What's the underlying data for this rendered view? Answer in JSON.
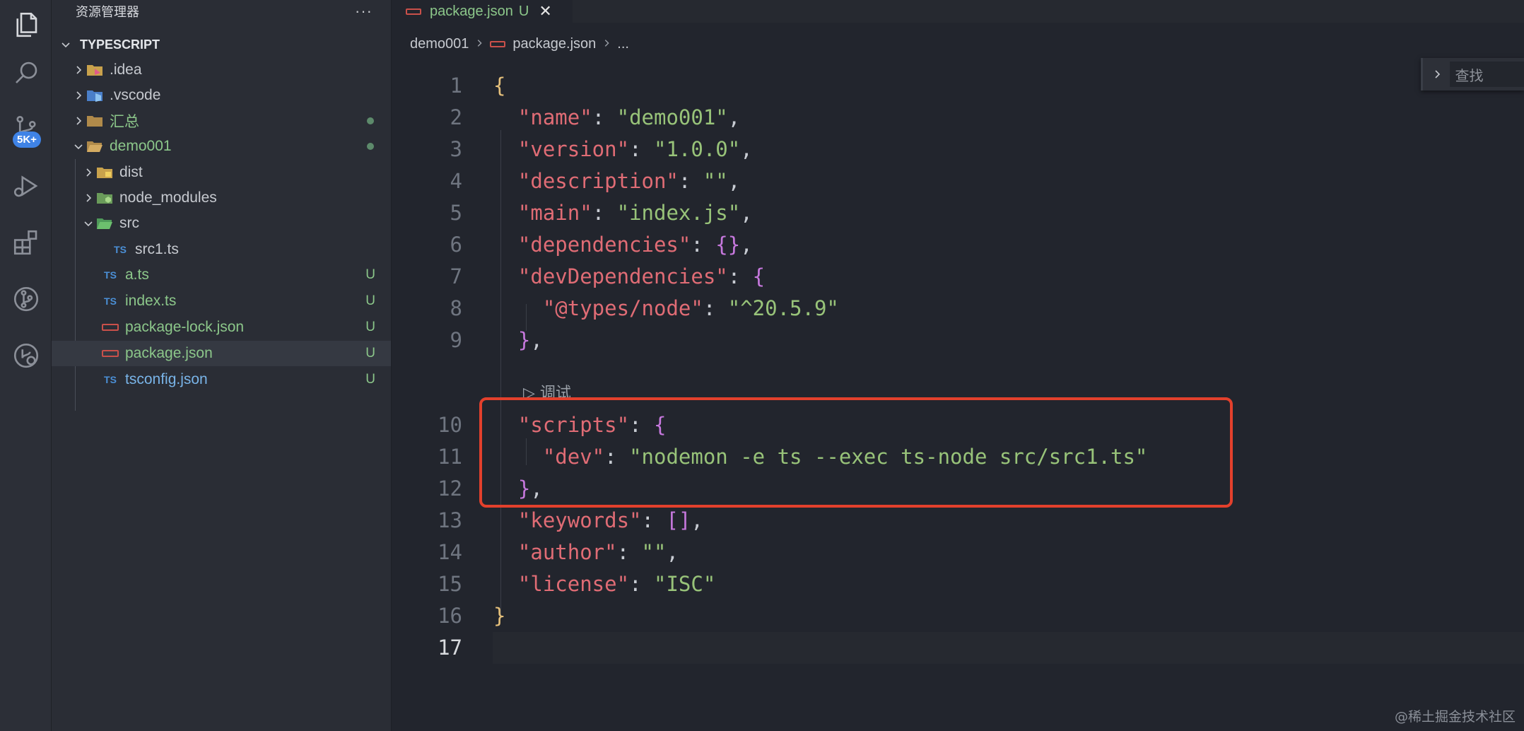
{
  "activity_bar": {
    "badge": "5K+"
  },
  "sidebar": {
    "title": "资源管理器",
    "more": "···",
    "section": "TYPESCRIPT",
    "items": [
      {
        "label": ".idea",
        "status": ""
      },
      {
        "label": ".vscode",
        "status": ""
      },
      {
        "label": "汇总",
        "status": "dot"
      },
      {
        "label": "demo001",
        "status": "dot"
      },
      {
        "label": "dist",
        "status": ""
      },
      {
        "label": "node_modules",
        "status": ""
      },
      {
        "label": "src",
        "status": ""
      },
      {
        "label": "src1.ts",
        "status": ""
      },
      {
        "label": "a.ts",
        "status": "U"
      },
      {
        "label": "index.ts",
        "status": "U"
      },
      {
        "label": "package-lock.json",
        "status": "U"
      },
      {
        "label": "package.json",
        "status": "U"
      },
      {
        "label": "tsconfig.json",
        "status": "U"
      }
    ],
    "ts_icon_text": "TS"
  },
  "tab": {
    "name": "package.json",
    "status": "U",
    "close": "✕"
  },
  "breadcrumb": {
    "folder": "demo001",
    "file": "package.json",
    "more": "..."
  },
  "find": {
    "placeholder": "查找"
  },
  "editor": {
    "line_numbers": [
      "1",
      "2",
      "3",
      "4",
      "5",
      "6",
      "7",
      "8",
      "9",
      "10",
      "11",
      "12",
      "13",
      "14",
      "15",
      "16",
      "17"
    ],
    "codelens": "▷ 调试",
    "lines": {
      "l1": "{",
      "name_k": "\"name\"",
      "name_v": "\"demo001\"",
      "version_k": "\"version\"",
      "version_v": "\"1.0.0\"",
      "description_k": "\"description\"",
      "description_v": "\"\"",
      "main_k": "\"main\"",
      "main_v": "\"index.js\"",
      "deps_k": "\"dependencies\"",
      "deps_v": "{}",
      "devdeps_k": "\"devDependencies\"",
      "devdeps_open": "{",
      "types_k": "\"@types/node\"",
      "types_v": "\"^20.5.9\"",
      "devdeps_close": "}",
      "scripts_k": "\"scripts\"",
      "scripts_open": "{",
      "dev_k": "\"dev\"",
      "dev_v": "\"nodemon -e ts --exec ts-node src/src1.ts\"",
      "scripts_close": "}",
      "keywords_k": "\"keywords\"",
      "keywords_v": "[]",
      "author_k": "\"author\"",
      "author_v": "\"\"",
      "license_k": "\"license\"",
      "license_v": "\"ISC\"",
      "l16": "}"
    }
  },
  "watermark": "@稀土掘金技术社区"
}
